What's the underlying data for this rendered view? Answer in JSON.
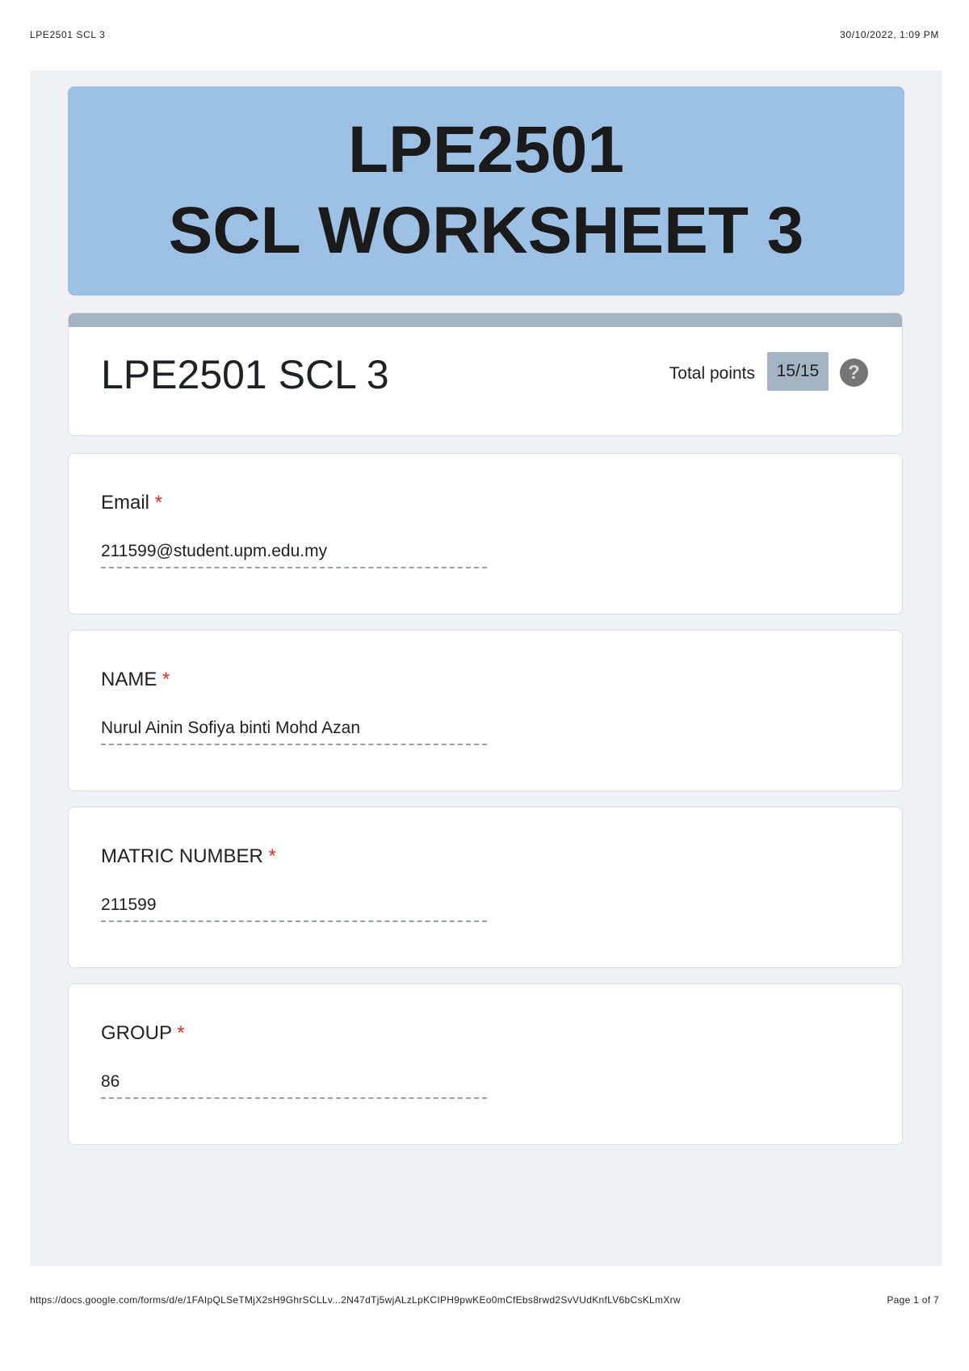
{
  "print_header": {
    "doc_title": "LPE2501 SCL 3",
    "printed_at": "30/10/2022, 1:09 PM"
  },
  "banner": {
    "line1": "LPE2501",
    "line2": "SCL WORKSHEET 3"
  },
  "form": {
    "title": "LPE2501 SCL 3",
    "total_points_label": "Total points",
    "score": "15/15",
    "help_glyph": "?",
    "required_marker": "*"
  },
  "questions": [
    {
      "label": "Email",
      "answer": "211599@student.upm.edu.my"
    },
    {
      "label": "NAME",
      "answer": "Nurul Ainin Sofiya binti Mohd Azan"
    },
    {
      "label": "MATRIC NUMBER",
      "answer": "211599"
    },
    {
      "label": "GROUP",
      "answer": "86"
    }
  ],
  "print_footer": {
    "url": "https://docs.google.com/forms/d/e/1FAIpQLSeTMjX2sH9GhrSCLLv...2N47dTj5wjALzLpKCIPH9pwKEo0mCfEbs8rwd2SvVUdKnfLV6bCsKLmXrw",
    "page": "Page 1 of 7"
  },
  "colors": {
    "banner_bg": "#9dc0e5",
    "accent": "#a4b4c2",
    "required": "#d93025",
    "page_bg": "#f0f1f4"
  }
}
